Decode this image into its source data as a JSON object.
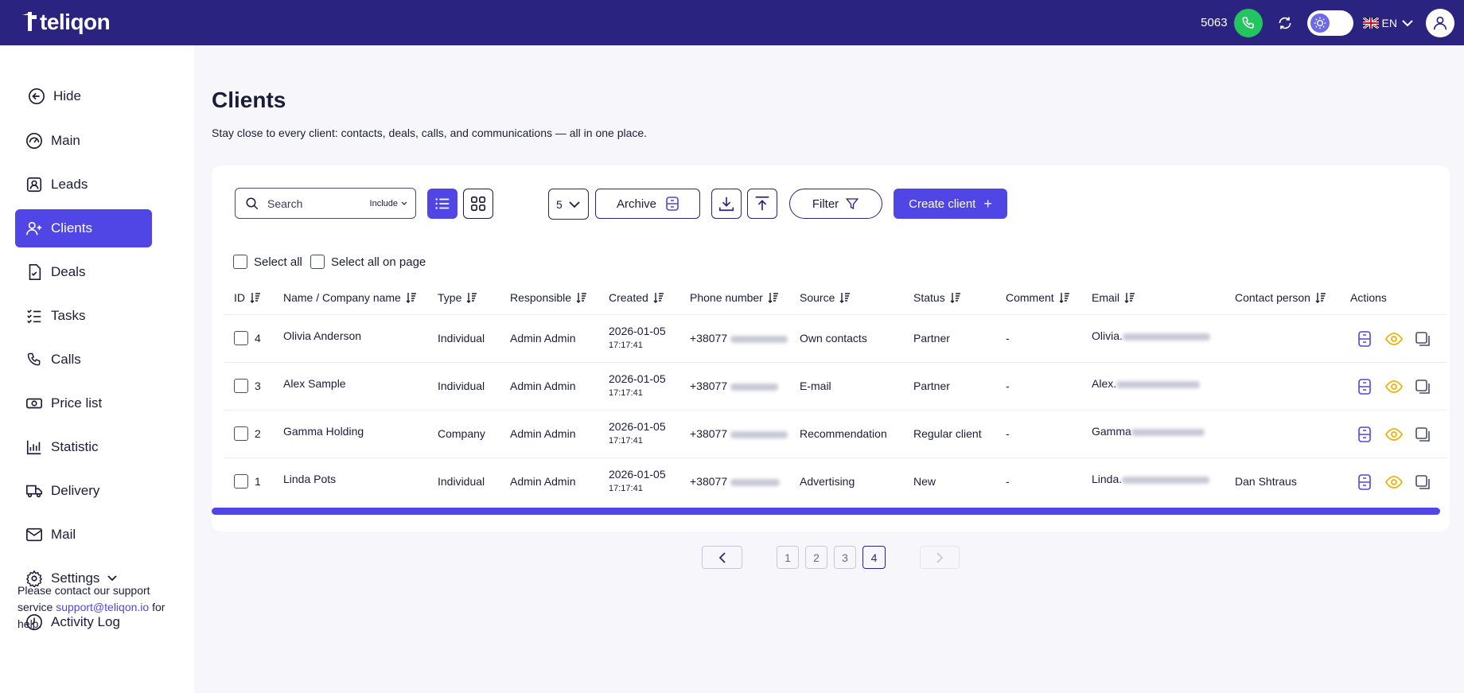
{
  "brand": {
    "name": "teliqon"
  },
  "topbar": {
    "extension": "5063",
    "language": "EN"
  },
  "sidebar": {
    "items": [
      {
        "label": "Hide",
        "icon": "arrow-left-circle-icon"
      },
      {
        "label": "Main",
        "icon": "gauge-icon"
      },
      {
        "label": "Leads",
        "icon": "user-badge-icon"
      },
      {
        "label": "Clients",
        "icon": "user-plus-icon"
      },
      {
        "label": "Deals",
        "icon": "document-check-icon"
      },
      {
        "label": "Tasks",
        "icon": "checklist-icon"
      },
      {
        "label": "Calls",
        "icon": "phone-icon"
      },
      {
        "label": "Price list",
        "icon": "banknote-icon"
      },
      {
        "label": "Statistic",
        "icon": "bar-chart-icon"
      },
      {
        "label": "Delivery",
        "icon": "truck-icon"
      },
      {
        "label": "Mail",
        "icon": "mail-icon"
      },
      {
        "label": "Settings",
        "icon": "gear-icon"
      },
      {
        "label": "Activity Log",
        "icon": "clock-icon"
      }
    ],
    "active": "Clients",
    "support": {
      "before": "Please contact our support service ",
      "link": "support@teliqon.io",
      "after": " for help."
    }
  },
  "page": {
    "title": "Clients",
    "subtitle": "Stay close to every client: contacts, deals, calls, and communications — all in one place."
  },
  "toolbar": {
    "search_placeholder": "Search",
    "search_mode": "Include",
    "per_page": "5",
    "archive_label": "Archive",
    "filter_label": "Filter",
    "create_label": "Create client"
  },
  "selection": {
    "select_all": "Select all",
    "select_all_page": "Select all on page"
  },
  "table": {
    "columns": [
      "ID",
      "Name / Company name",
      "Type",
      "Responsible",
      "Created",
      "Phone number",
      "Source",
      "Status",
      "Comment",
      "Email",
      "Contact person",
      "Actions"
    ],
    "rows": [
      {
        "id": "4",
        "name": "Olivia Anderson",
        "type": "Individual",
        "responsible": "Admin Admin",
        "created_date": "2026-01-05",
        "created_time": "17:17:41",
        "phone": "+38077",
        "source": "Own contacts",
        "status": "Partner",
        "comment": "-",
        "email": "Olivia.",
        "contact": ""
      },
      {
        "id": "3",
        "name": "Alex Sample",
        "type": "Individual",
        "responsible": "Admin Admin",
        "created_date": "2026-01-05",
        "created_time": "17:17:41",
        "phone": "+38077",
        "source": "E-mail",
        "status": "Partner",
        "comment": "-",
        "email": "Alex.",
        "contact": ""
      },
      {
        "id": "2",
        "name": "Gamma Holding",
        "type": "Company",
        "responsible": "Admin Admin",
        "created_date": "2026-01-05",
        "created_time": "17:17:41",
        "phone": "+38077",
        "source": "Recommendation",
        "status": "Regular client",
        "comment": "-",
        "email": "Gamma",
        "contact": ""
      },
      {
        "id": "1",
        "name": "Linda Pots",
        "type": "Individual",
        "responsible": "Admin Admin",
        "created_date": "2026-01-05",
        "created_time": "17:17:41",
        "phone": "+38077",
        "source": "Advertising",
        "status": "New",
        "comment": "-",
        "email": "Linda.",
        "contact": "Dan Shtraus"
      }
    ]
  },
  "pagination": {
    "pages": [
      "1",
      "2",
      "3",
      "4"
    ],
    "current": "4"
  },
  "colors": {
    "primary": "#4f46e5",
    "topbar": "#2a2380",
    "call": "#22c55e",
    "view_icon": "#eab308"
  }
}
